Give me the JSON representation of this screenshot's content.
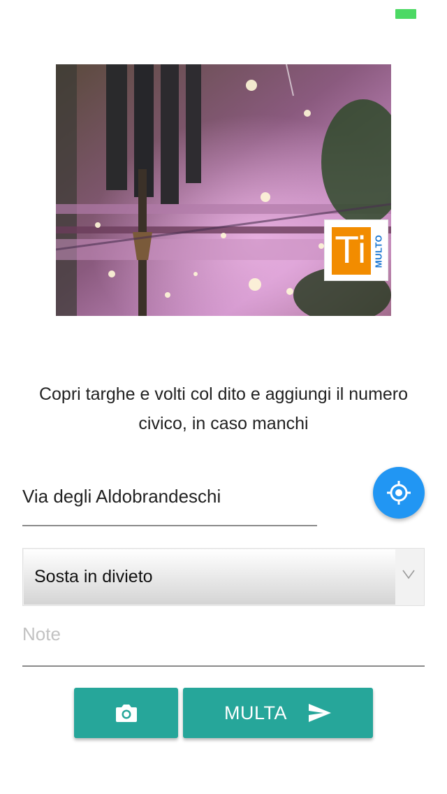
{
  "status_bar": {
    "battery_color": "#4cd964"
  },
  "photo": {
    "logo": {
      "main_text": "Ti",
      "side_text": "MULTO",
      "box_color": "#f28c00",
      "side_color": "#1976d2"
    }
  },
  "instructions": {
    "text": "Copri targhe e volti col dito e aggiungi il numero civico, in caso manchi"
  },
  "address": {
    "value": "Via degli Aldobrandeschi"
  },
  "locate_button": {
    "icon": "gps-target-icon",
    "color": "#2196f3"
  },
  "violation_select": {
    "selected": "Sosta in divieto"
  },
  "notes": {
    "placeholder": "Note",
    "value": ""
  },
  "actions": {
    "camera_icon": "camera-icon",
    "submit_label": "MULTA",
    "submit_icon": "send-icon",
    "color": "#26a69a"
  }
}
